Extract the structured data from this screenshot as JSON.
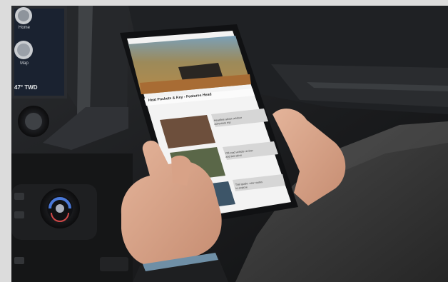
{
  "scene": {
    "infotainment": {
      "home_label": "Home",
      "map_label": "Map",
      "temperature": "47° TWD"
    },
    "tablet": {
      "headline": "Heat Pockets & Key - Features Head",
      "articles": [
        {
          "title_lines": [
            "Headline about outdoor",
            "adventure trip"
          ]
        },
        {
          "title_lines": [
            "Off-road vehicle review",
            "and test drive"
          ]
        },
        {
          "title_lines": [
            "Trail guide: new routes",
            "to explore"
          ]
        }
      ]
    },
    "colors": {
      "dashboard": "#151617",
      "tablet_screen": "#f3f3f3",
      "sky_hero": "#b68a48",
      "knob_blue": "#4a78d8",
      "sweater": "#3c3c3c"
    }
  }
}
